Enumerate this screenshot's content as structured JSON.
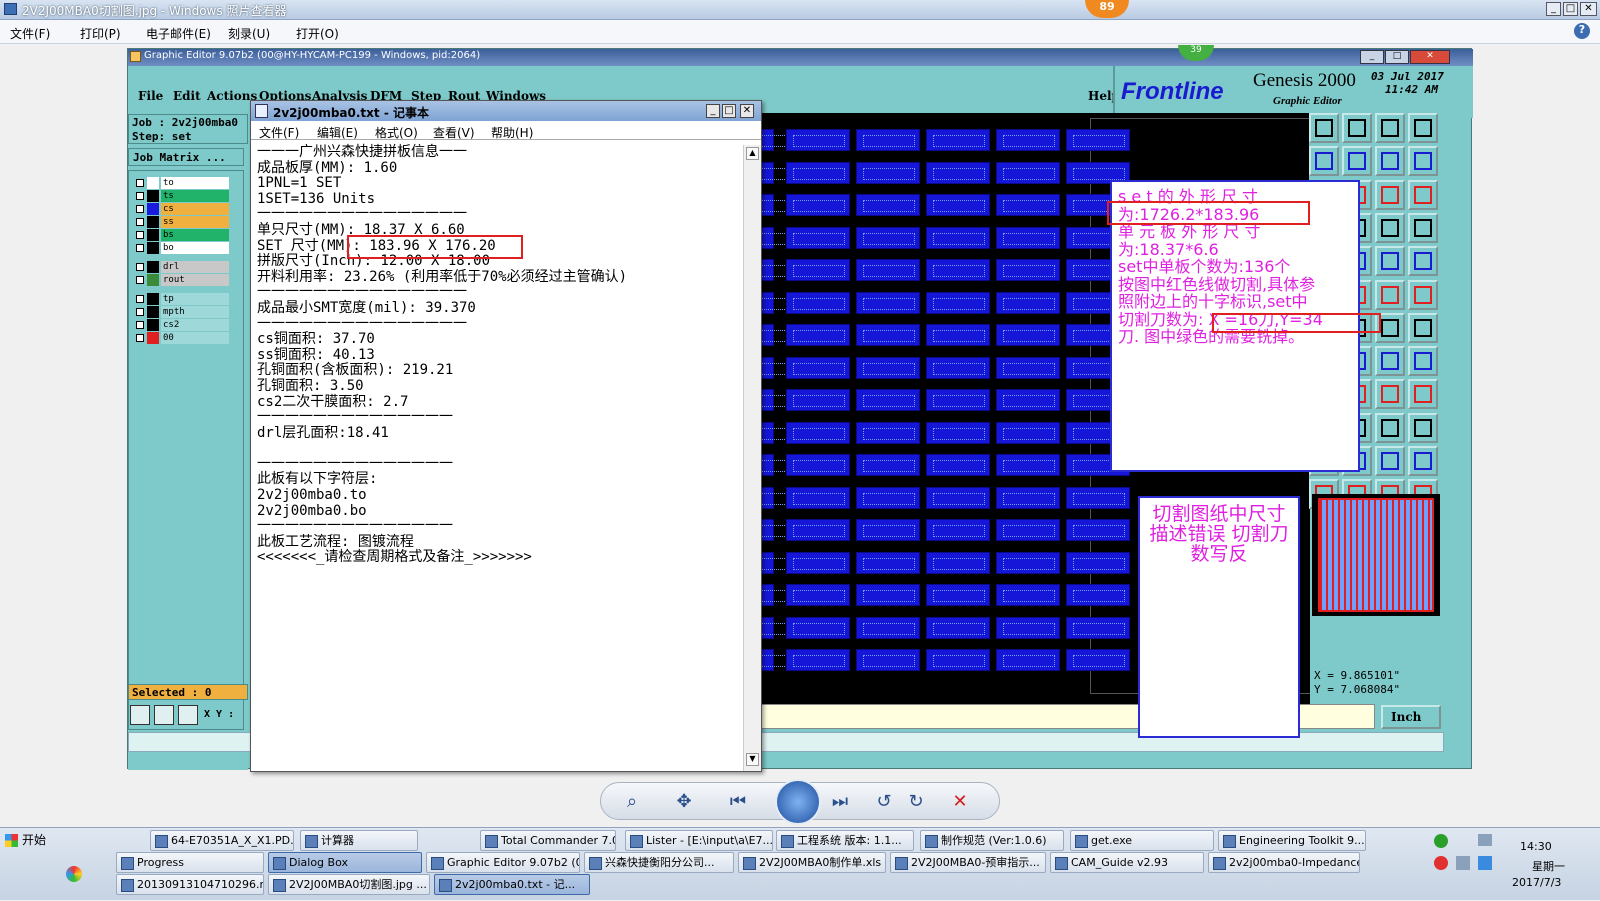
{
  "viewer": {
    "title": "2V2J00MBA0切割图.jpg - Windows 照片查看器",
    "menu": [
      "文件(F)",
      "打印(P)",
      "电子邮件(E)",
      "刻录(U)",
      "打开(O)"
    ],
    "badge_top": "89",
    "help_icon": "help-icon"
  },
  "genesis": {
    "title": "Graphic Editor 9.07b2 (00@HY-HYCAM-PC199 - Windows, pid:2064)",
    "menu": [
      "File",
      "Edit",
      "Actions",
      "Options",
      "Analysis",
      "DFM",
      "Step",
      "Rout",
      "Windows"
    ],
    "help": "Help",
    "brand": "Frontline",
    "product": "Genesis 2000",
    "subtitle": "Graphic Editor",
    "date": "03 Jul 2017",
    "time": "11:42 AM",
    "badge": "39",
    "job": "Job : 2v2j00mba0",
    "step": "Step: set",
    "job_matrix": "Job Matrix ...",
    "layers": [
      {
        "name": "to",
        "color": "#ffffff",
        "bg": "#ffffff"
      },
      {
        "name": "ts",
        "color": "#000000",
        "bg": "#22b36b"
      },
      {
        "name": "cs",
        "color": "#1a1ae0",
        "bg": "#f0b040"
      },
      {
        "name": "ss",
        "color": "#000000",
        "bg": "#f0b040"
      },
      {
        "name": "bs",
        "color": "#000000",
        "bg": "#22b36b"
      },
      {
        "name": "bo",
        "color": "#000000",
        "bg": "#ffffff"
      },
      {
        "name": "drl",
        "color": "#000000",
        "bg": "#c8c8c8"
      },
      {
        "name": "rout",
        "color": "#3a8a3a",
        "bg": "#c8c8c8"
      },
      {
        "name": "tp",
        "color": "#000000",
        "bg": "#9fd8d8"
      },
      {
        "name": "mpth",
        "color": "#000000",
        "bg": "#9fd8d8"
      },
      {
        "name": "cs2",
        "color": "#000000",
        "bg": "#9fd8d8"
      },
      {
        "name": "00",
        "color": "#e02020",
        "bg": "#9fd8d8"
      }
    ],
    "selected": "Selected : 0",
    "xy_label": "X Y :",
    "coord_x": "X = 9.865101\"",
    "coord_y": "Y = 7.068084\"",
    "units": "Inch"
  },
  "notepad": {
    "title": "2v2j00mba0.txt - 记事本",
    "menu": [
      "文件(F)",
      "编辑(E)",
      "格式(O)",
      "查看(V)",
      "帮助(H)"
    ],
    "lines": [
      "一一一广州兴森快捷拼板信息一一",
      "成品板厚(MM): 1.60",
      "1PNL=1 SET",
      "1SET=136 Units",
      "一一一一一一一一一一一一一一一",
      "单只尺寸(MM): 18.37 X 6.60",
      "SET 尺寸(MM): 183.96 X 176.20",
      "拼版尺寸(Inch): 12.00 X 18.00",
      "开料利用率: 23.26% (利用率低于70%必须经过主管确认)",
      "一一一一一一一一一一一一一一一",
      "成品最小SMT宽度(mil): 39.370",
      "一一一一一一一一一一一一一一一",
      "cs铜面积: 37.70",
      "ss铜面积: 40.13",
      "孔铜面积(含板面积): 219.21",
      "孔铜面积: 3.50",
      "cs2二次干膜面积: 2.7",
      "一一一一一一一一一一一一一一",
      "drl层孔面积:18.41",
      "",
      "一一一一一一一一一一一一一一",
      "此板有以下字符层:",
      "2v2j00mba0.to",
      "2v2j00mba0.bo",
      "一一一一一一一一一一一一一一",
      "此板工艺流程: 图镀流程",
      "<<<<<<<_请检查周期格式及备注_>>>>>>>"
    ]
  },
  "annotation": {
    "note_lines": [
      "s e t 的 外 形 尺 寸",
      "为:1726.2*183.96",
      "单 元 板 外 形 尺 寸",
      "为:18.37*6.6",
      "set中单板个数为:136个",
      "按图中红色线做切割,具体参",
      "照附边上的十字标识,set中",
      "切割刀数为: X =16刀,Y=34",
      "刀. 图中绿色的需要铣掉。"
    ],
    "error_text": "切割图纸中尺寸描述错误 切割刀数写反"
  },
  "taskbar": {
    "start": "开始",
    "row1": [
      "64-E70351A_X_X1.PD...",
      "计算器",
      "Total Commander 7.0 ...",
      "Lister - [E:\\input\\a\\E7...",
      "工程系统 版本: 1.1...",
      "制作规范 (Ver:1.0.6)",
      "get.exe",
      "Engineering Toolkit 9...."
    ],
    "row2": [
      "Progress",
      "Dialog Box",
      "Graphic Editor 9.07b2 (0...",
      "兴森快捷衡阳分公司...",
      "2V2J00MBA0制作单.xls ...",
      "2V2J00MBA0-预审指示...",
      "CAM_Guide v2.93",
      "2v2j00mba0-Impedance..."
    ],
    "row3": [
      "20130913104710296.rtf...",
      "2V2J00MBA0切割图.jpg ...",
      "2v2j00mba0.txt - 记..."
    ],
    "clock_time": "14:30",
    "clock_day": "星期一",
    "clock_date": "2017/7/3"
  }
}
